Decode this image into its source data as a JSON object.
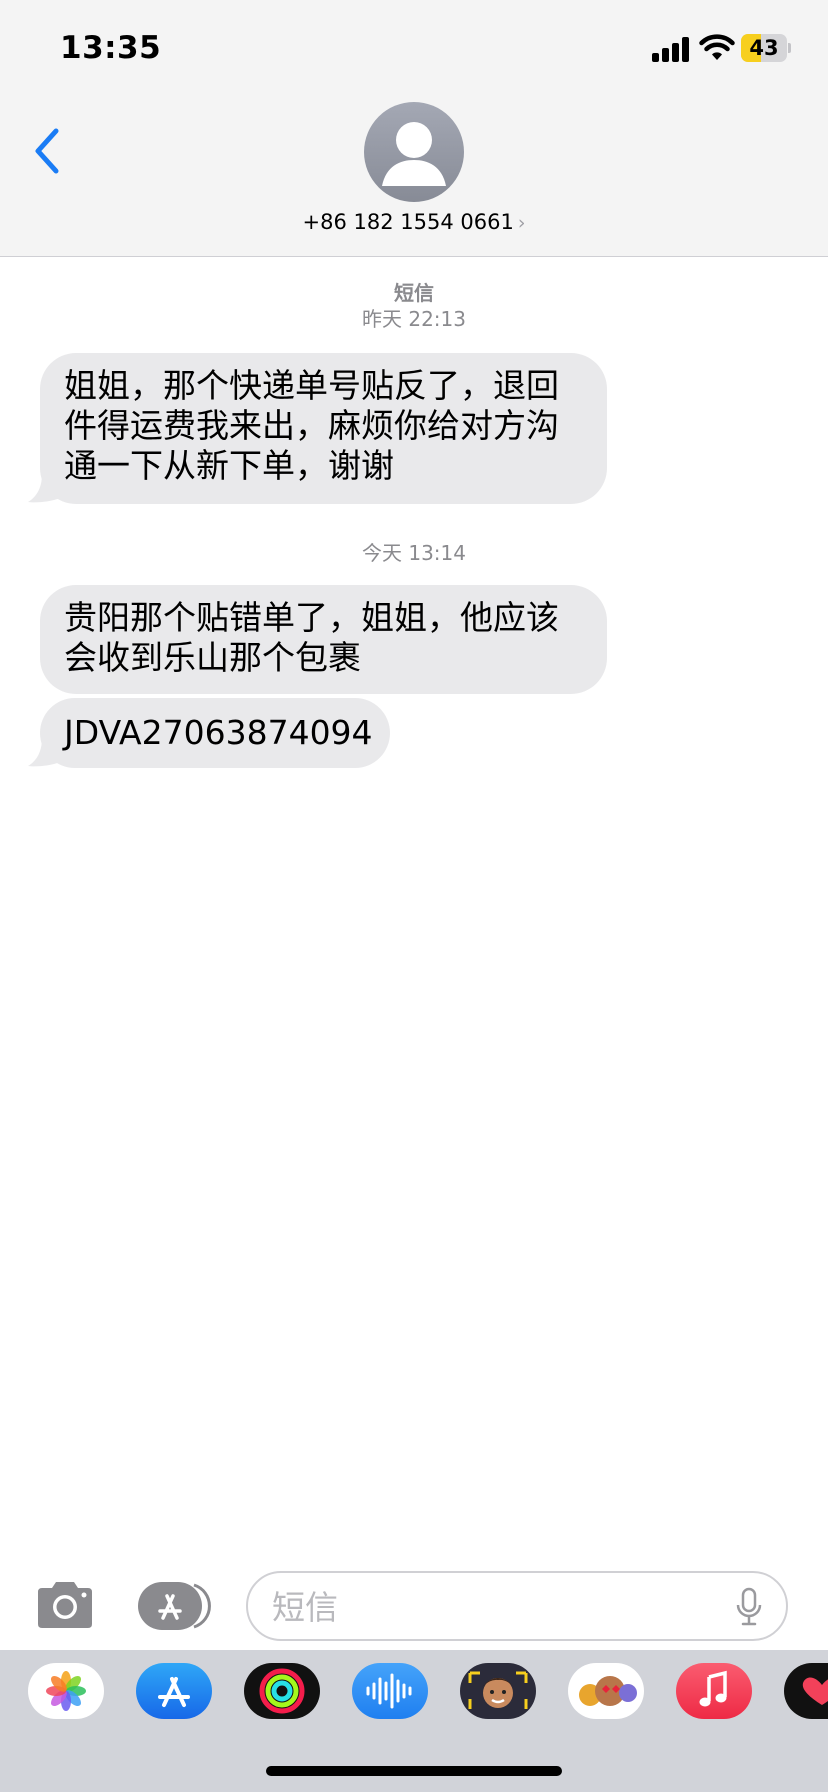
{
  "status_bar": {
    "time": "13:35",
    "battery": "43",
    "battery_level": 0.43
  },
  "header": {
    "contact": "+86 182 1554 0661",
    "chevron": "›"
  },
  "thread": [
    {
      "type": "timestamp",
      "label": "短信",
      "time": "昨天 22:13"
    },
    {
      "type": "message",
      "text": "姐姐，那个快递单号贴反了，退回\n件得运费我来出，麻烦你给对方沟\n通一下从新下单，谢谢"
    },
    {
      "type": "timestamp",
      "time": "今天 13:14"
    },
    {
      "type": "message",
      "text": "贵阳那个贴错单了，姐姐，他应该\n会收到乐山那个包裹"
    },
    {
      "type": "message",
      "text": "JDVA27063874094"
    }
  ],
  "input": {
    "placeholder": "短信"
  },
  "app_drawer": {
    "apps": [
      "photos-app-icon",
      "app-store-app-icon",
      "activity-app-icon",
      "audio-message-app-icon",
      "memoji-app-icon",
      "animoji-stickers-app-icon",
      "music-app-icon",
      "digital-touch-app-icon"
    ]
  },
  "colors": {
    "accent": "#1a7cf5",
    "bubble": "#e9e9eb",
    "header_bg": "#f4f4f4",
    "drawer_bg": "#d1d3d9",
    "battery": "#f7cf1e"
  }
}
